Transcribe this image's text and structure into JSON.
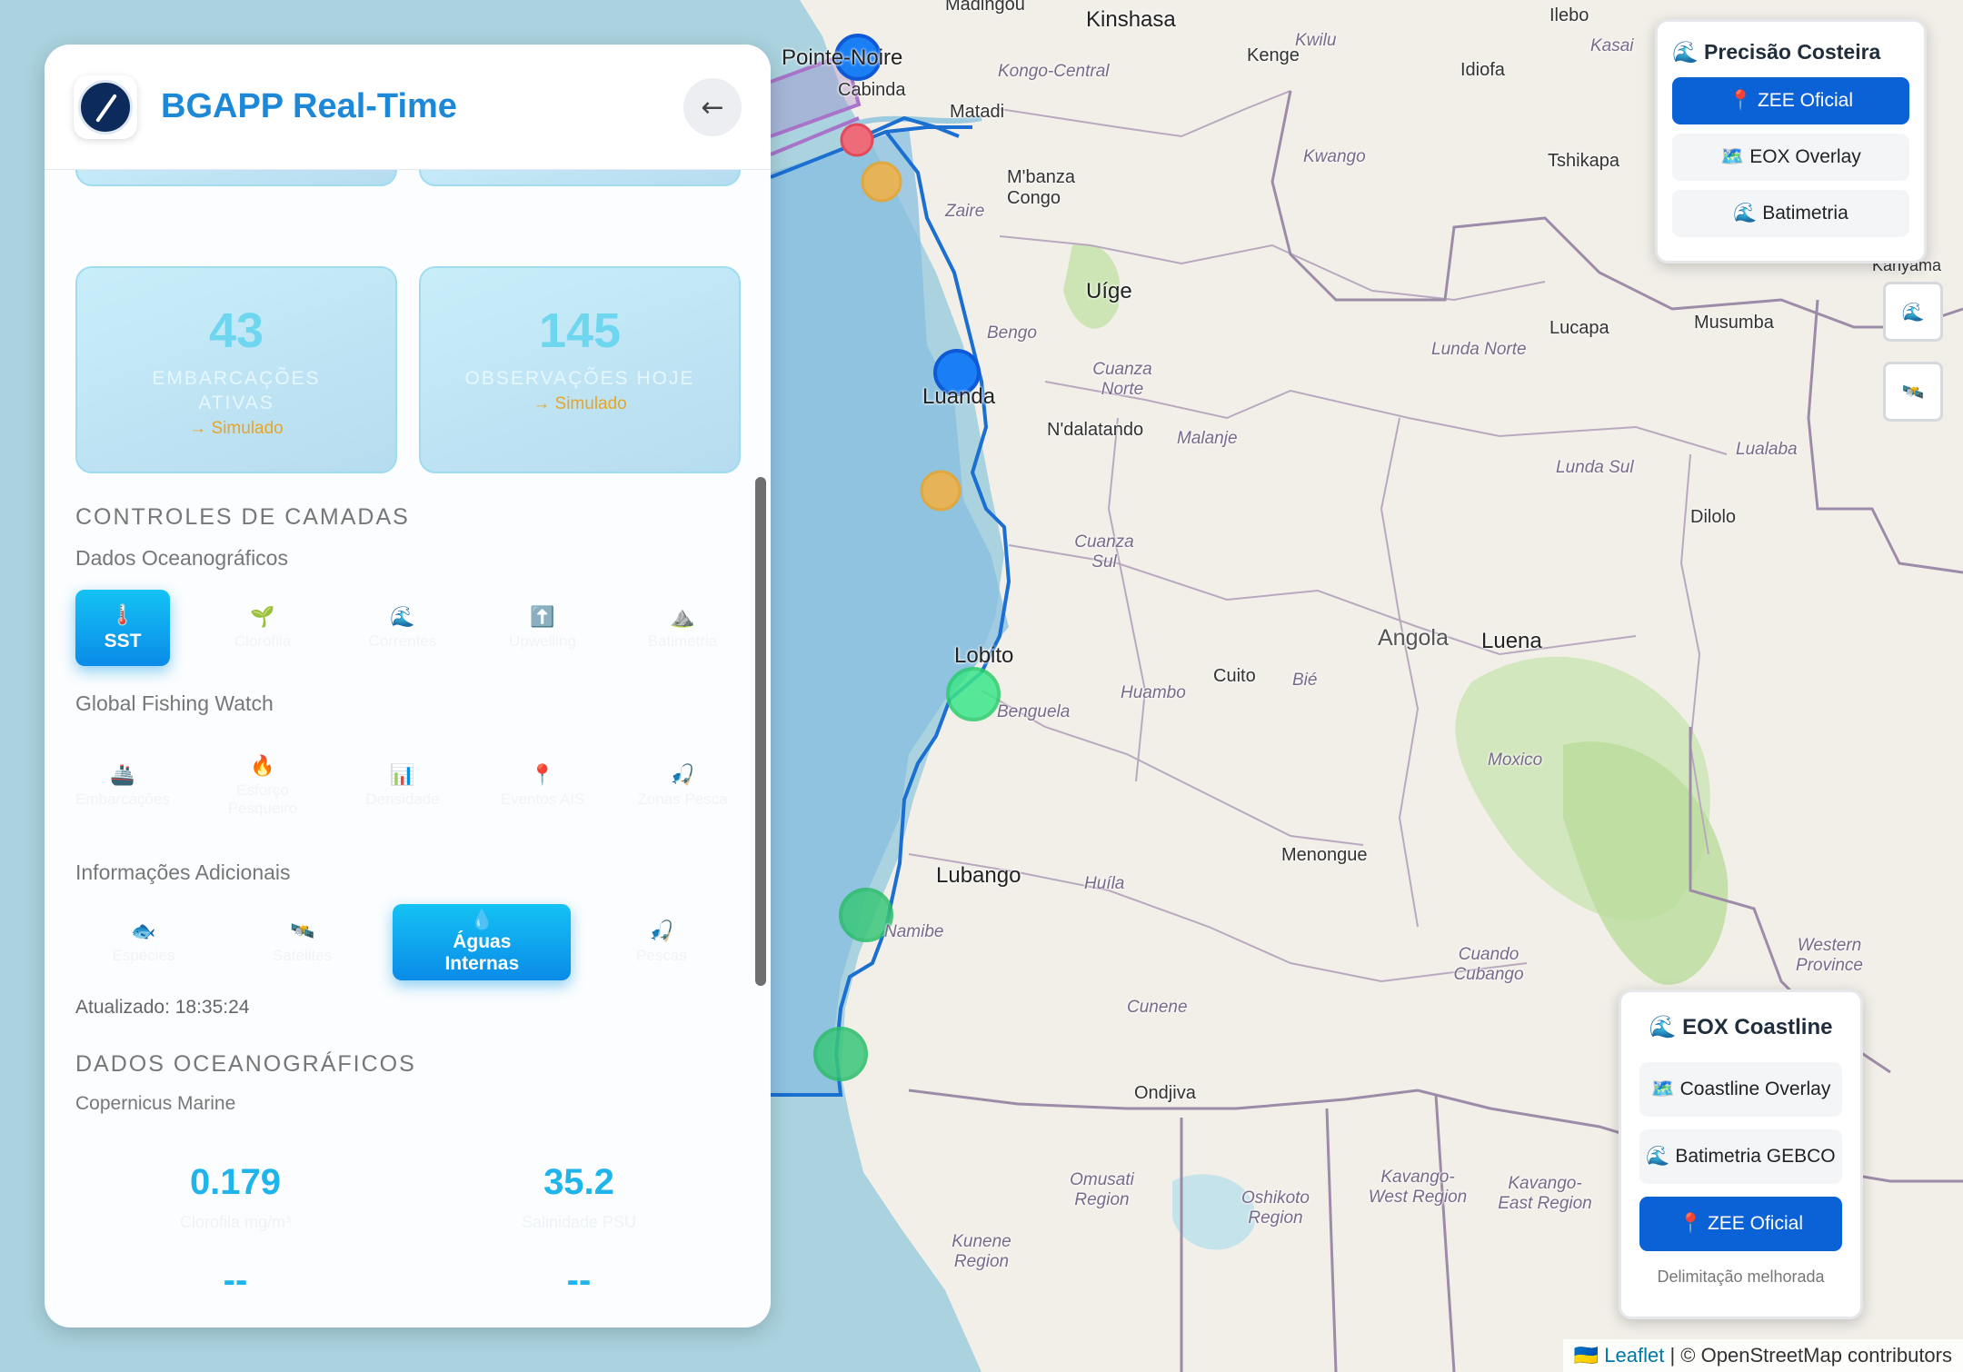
{
  "app": {
    "title": "BGAPP Real-Time",
    "back_icon": "←"
  },
  "stats": [
    {
      "value": "43",
      "label": "EMBARCAÇÕES ATIVAS",
      "note": "→ Simulado"
    },
    {
      "value": "145",
      "label": "OBSERVAÇÕES HOJE",
      "note": "→ Simulado"
    }
  ],
  "layers": {
    "section_title": "CONTROLES DE CAMADAS",
    "oceanographic": {
      "title": "Dados Oceanográficos",
      "buttons": [
        {
          "icon": "🌡️",
          "label": "SST",
          "active": true
        },
        {
          "icon": "🌱",
          "label": "Clorofila",
          "active": false
        },
        {
          "icon": "🌊",
          "label": "Correntes",
          "active": false
        },
        {
          "icon": "⬆️",
          "label": "Upwelling",
          "active": false
        },
        {
          "icon": "⛰️",
          "label": "Batimetria",
          "active": false
        }
      ]
    },
    "gfw": {
      "title": "Global Fishing Watch",
      "buttons": [
        {
          "icon": "🚢",
          "label": "Embarcações",
          "active": false
        },
        {
          "icon": "🔥",
          "label": "Esforço Pesqueiro",
          "active": false
        },
        {
          "icon": "📊",
          "label": "Densidade",
          "active": false
        },
        {
          "icon": "📍",
          "label": "Eventos AIS",
          "active": false
        },
        {
          "icon": "🎣",
          "label": "Zonas Pesca",
          "active": false
        }
      ]
    },
    "additional": {
      "title": "Informações Adicionais",
      "buttons": [
        {
          "icon": "🐟",
          "label": "Espécies",
          "active": false
        },
        {
          "icon": "🛰️",
          "label": "Satélites",
          "active": false
        },
        {
          "icon": "💧",
          "label": "Águas Internas",
          "active": true
        },
        {
          "icon": "🎣",
          "label": "Pescas",
          "active": false
        }
      ]
    },
    "updated": "Atualizado: 18:35:24"
  },
  "ocean": {
    "title": "DADOS OCEANOGRÁFICOS",
    "source": "Copernicus Marine",
    "values": [
      {
        "value": "0.179",
        "label": "Clorofila mg/m³"
      },
      {
        "value": "35.2",
        "label": "Salinidade PSU"
      },
      {
        "value": "--",
        "label": ""
      },
      {
        "value": "--",
        "label": ""
      }
    ]
  },
  "coastal_control": {
    "title": "🌊 Precisão Costeira",
    "buttons": [
      {
        "label": "📍 ZEE Oficial",
        "primary": true
      },
      {
        "label": "🗺️ EOX Overlay",
        "primary": false
      },
      {
        "label": "🌊 Batimetria",
        "primary": false
      }
    ]
  },
  "eox_control": {
    "title": "🌊 EOX Coastline",
    "buttons": [
      {
        "label": "🗺️ Coastline Overlay",
        "primary": false
      },
      {
        "label": "🌊 Batimetria GEBCO",
        "primary": false
      },
      {
        "label": "📍 ZEE Oficial",
        "primary": true
      }
    ],
    "footer": "Delimitação melhorada"
  },
  "small_controls": [
    {
      "icon": "🌊"
    },
    {
      "icon": "🛰️"
    }
  ],
  "attribution": {
    "flag": "🇺🇦",
    "leaflet": "Leaflet",
    "rest": "| © OpenStreetMap contributors"
  },
  "map_places": [
    "Madingou",
    "Kinshasa",
    "Kwilu",
    "Ilebo",
    "Kasai",
    "Pointe-Noire",
    "Cabinda",
    "Kenge",
    "Idiofa",
    "Kongo-Central",
    "Matadi",
    "Kwango",
    "Tshikapa",
    "M'banza Congo",
    "Zaire",
    "Uíge",
    "Bengo",
    "Cuanza Norte",
    "Lunda Norte",
    "Lucapa",
    "Musumba",
    "Kanyama",
    "Luanda",
    "N'dalatando",
    "Malanje",
    "Lualaba",
    "Lunda Sul",
    "Dilolo",
    "Cuanza Sul",
    "Angola",
    "Luena",
    "Lobito",
    "Benguela",
    "Huambo",
    "Cuito",
    "Bié",
    "Moxico",
    "Lubango",
    "Huíla",
    "Namibe",
    "Menongue",
    "Cuando Cubango",
    "Western Province",
    "Cunene",
    "Ondjiva",
    "Omusati Region",
    "Oshikoto Region",
    "Kavango-West Region",
    "Kavango-East Region",
    "Kunene Region"
  ]
}
